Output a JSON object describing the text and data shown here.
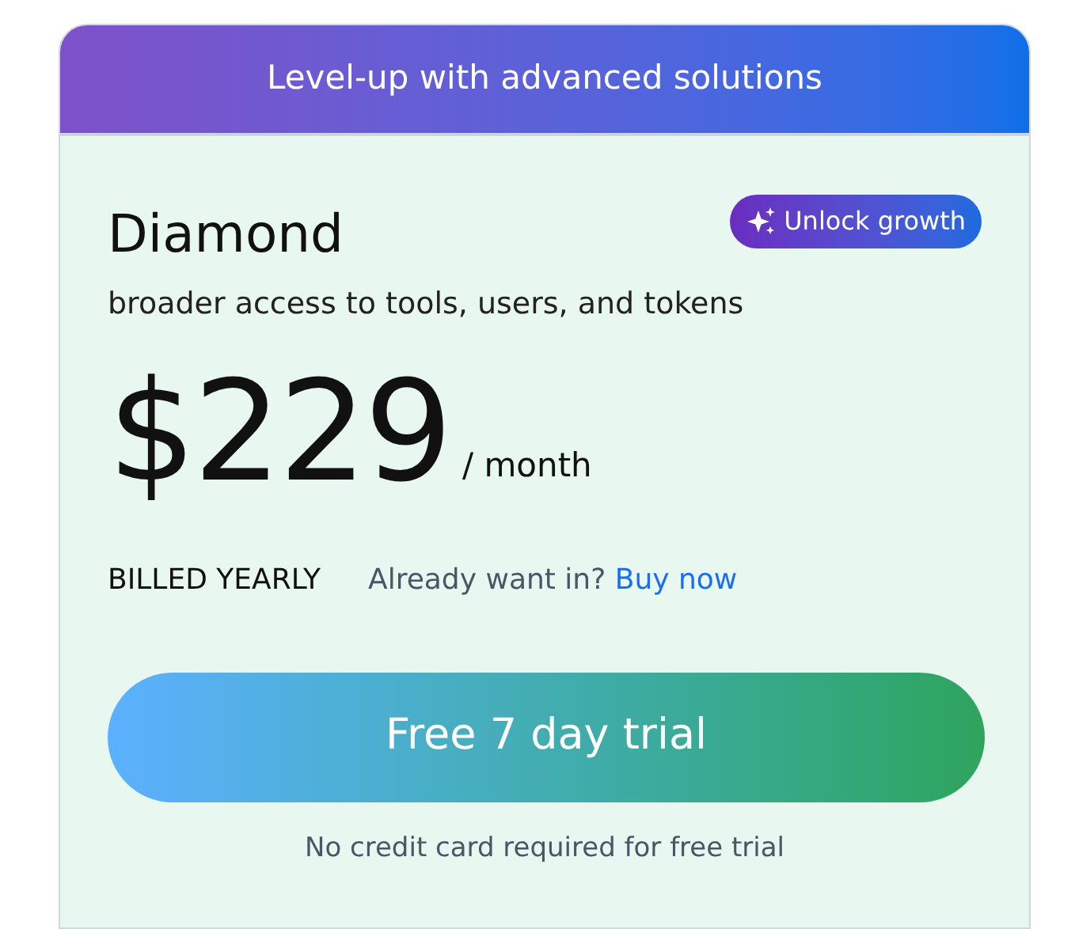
{
  "banner": {
    "text": "Level-up with advanced solutions"
  },
  "plan": {
    "name": "Diamond",
    "badge": "Unlock growth",
    "description": "broader access to tools, users, and tokens",
    "price": "$229",
    "period": "/ month",
    "billing": "BILLED YEARLY",
    "prompt": "Already want in?",
    "link": "Buy now"
  },
  "cta": {
    "label": "Free 7 day trial",
    "note": "No credit card required for free trial"
  }
}
